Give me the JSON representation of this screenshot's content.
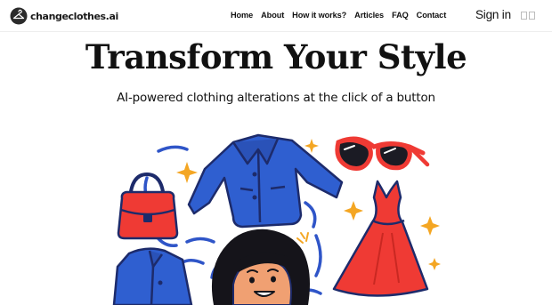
{
  "brand": {
    "name": "changeclothes.ai",
    "logo_icon": "hanger-logo-icon"
  },
  "nav": {
    "links": [
      "Home",
      "About",
      "How it works?",
      "Articles",
      "FAQ",
      "Contact"
    ],
    "signin": "Sign in",
    "menu_icon": "menu-icon"
  },
  "hero": {
    "title": "Transform Your Style",
    "subtitle": "AI-powered clothing alterations at the click of a button",
    "illustration_icons": [
      "handbag-icon",
      "jacket-icon",
      "sunglasses-icon",
      "dress-icon",
      "woman-avatar-icon",
      "sparkle-icon"
    ]
  },
  "colors": {
    "blue": "#2f5fd0",
    "red": "#ef3a34",
    "gold": "#f4a623",
    "navy": "#1d2b6b"
  }
}
